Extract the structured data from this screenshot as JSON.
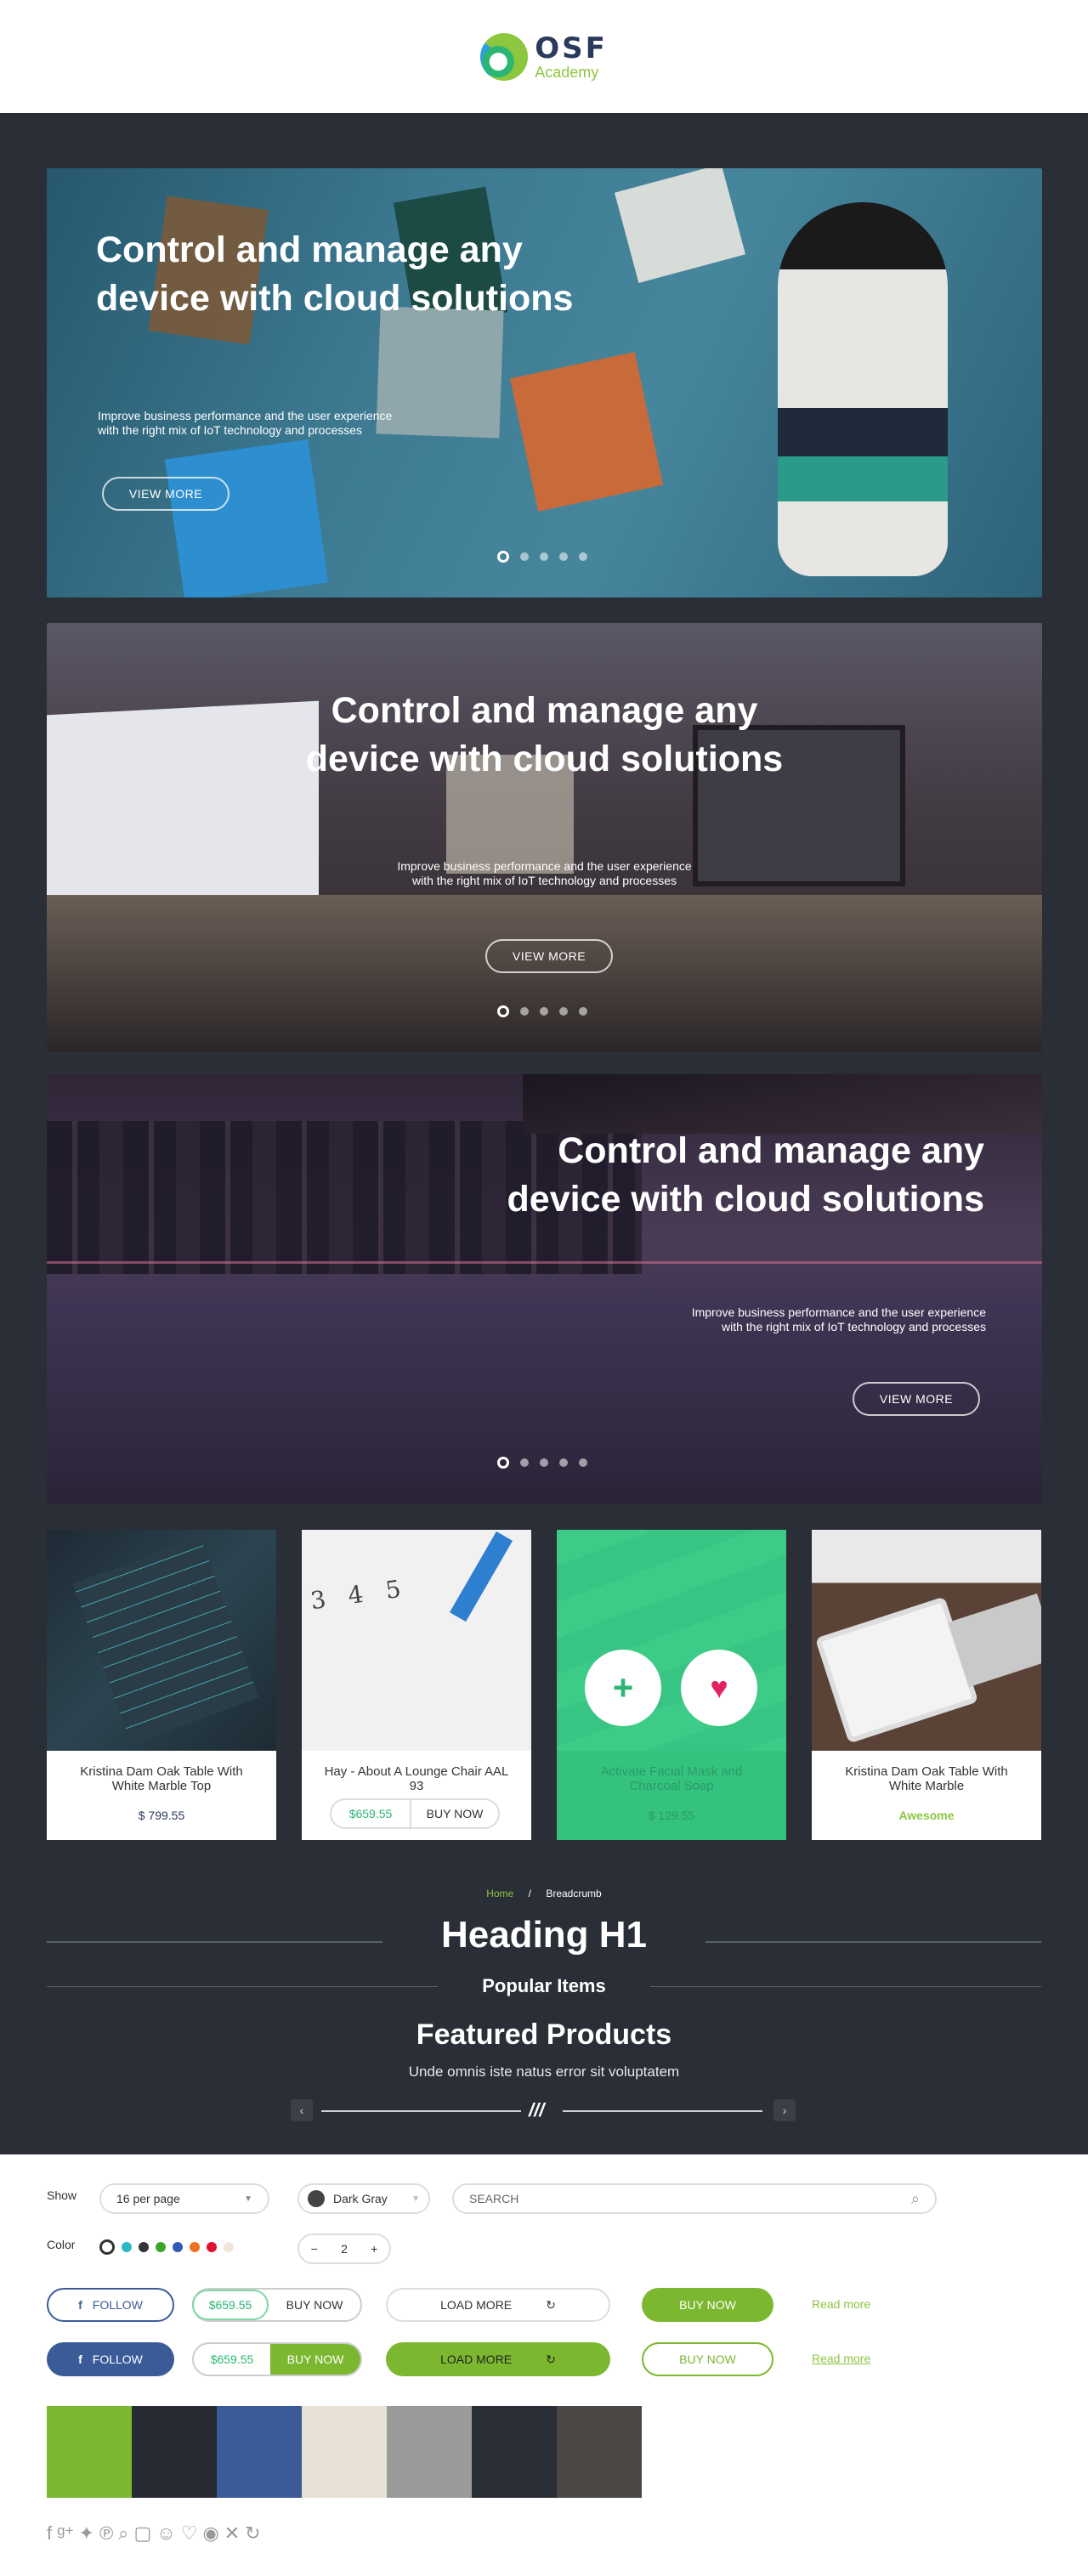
{
  "brand": {
    "name": "OSF",
    "sub": "Academy"
  },
  "hero": {
    "title_line1": "Control and manage any",
    "title_line2": "device with cloud solutions",
    "subtitle_line1": "Improve business performance and the user experience",
    "subtitle_line2": "with the right mix of IoT technology and processes",
    "button": "VIEW MORE"
  },
  "cards": [
    {
      "title": "Kristina Dam Oak Table With White Marble Top",
      "price": "$ 799.55"
    },
    {
      "title": "Hay - About A Lounge Chair AAL 93",
      "price": "$659.55",
      "buy": "BUY NOW"
    },
    {
      "title": "Activate Facial Mask and Charcoal Soap",
      "price": "$ 129.55"
    },
    {
      "title": "Kristina Dam Oak Table With White Marble",
      "badge": "Awesome"
    }
  ],
  "breadcrumb": {
    "home": "Home",
    "sep": "/",
    "current": "Breadcrumb"
  },
  "headings": {
    "h1": "Heading H1",
    "popular": "Popular Items",
    "featured": "Featured Products",
    "featured_sub": "Unde omnis iste natus error sit voluptatem"
  },
  "controls": {
    "show_label": "Show",
    "per_page": "16 per page",
    "color_select": "Dark Gray",
    "search_placeholder": "SEARCH",
    "color_label": "Color",
    "qty": "2",
    "minus": "−",
    "plus": "+"
  },
  "colors": {
    "dots": [
      "#ffffff",
      "#2db8c6",
      "#333333",
      "#3ba42a",
      "#2f5bb7",
      "#f07020",
      "#e01030",
      "#eee6d8"
    ],
    "swatches": [
      "#7cb82f",
      "#272b34",
      "#3b5b98",
      "#e8e1d6",
      "#9a9a9a",
      "#2a2e36",
      "#4b4846"
    ],
    "accent": "#8dc63f",
    "facebook": "#3b5b98"
  },
  "buttons": {
    "follow": "FOLLOW",
    "price": "$659.55",
    "buy_now": "BUY NOW",
    "load_more": "LOAD MORE",
    "read_more": "Read more"
  },
  "footer_icons": [
    "facebook-icon",
    "google-plus-icon",
    "twitter-icon",
    "pinterest-icon",
    "search-icon",
    "bag-icon",
    "user-icon",
    "heart-icon",
    "eye-icon",
    "close-icon",
    "refresh-icon"
  ]
}
